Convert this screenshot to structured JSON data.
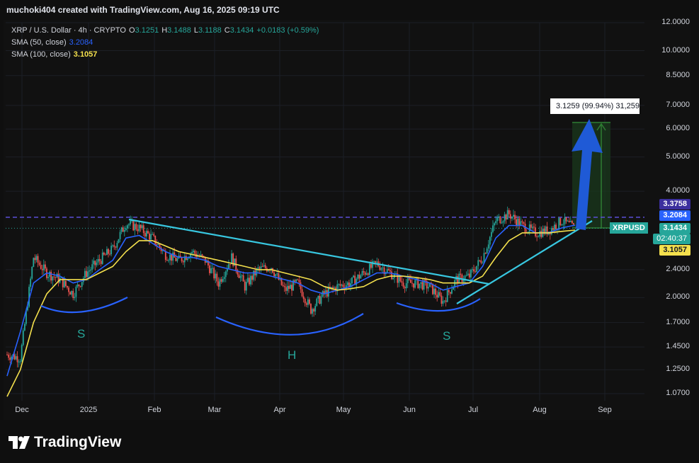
{
  "header": {
    "attribution": "muchoki404 created with TradingView.com, Aug 16, 2025 09:19 UTC"
  },
  "legend": {
    "symbol": "XRP / U.S. Dollar · 4h · CRYPTO",
    "open_key": "O",
    "open": "3.1251",
    "high_key": "H",
    "high": "3.1488",
    "low_key": "L",
    "low": "3.1188",
    "close_key": "C",
    "close": "3.1434",
    "change": "+0.0183 (+0.59%)",
    "sma50_label": "SMA (50, close)",
    "sma50_value": "3.2084",
    "sma100_label": "SMA (100, close)",
    "sma100_value": "3.1057"
  },
  "price_scale": {
    "ticks": [
      "12.0000",
      "10.0000",
      "8.5000",
      "7.0000",
      "6.0000",
      "5.0000",
      "4.0000",
      "2.4000",
      "2.0000",
      "1.7000",
      "1.4500",
      "1.2500",
      "1.0700"
    ],
    "tags": {
      "resistance": "3.3758",
      "sma50": "3.2084",
      "last_price": "3.1434",
      "countdown": "02:40:37",
      "sma100": "3.1057"
    }
  },
  "time_scale": {
    "ticks": [
      "Dec",
      "2025",
      "Feb",
      "Mar",
      "Apr",
      "May",
      "Jun",
      "Jul",
      "Aug",
      "Sep"
    ]
  },
  "annotations": {
    "target_box_label": "3.1259 (99.94%) 31,259",
    "symbol_tag": "XRPUSD",
    "left_shoulder": "S",
    "head": "H",
    "right_shoulder": "S"
  },
  "brand": {
    "name": "TradingView"
  },
  "colors": {
    "up": "#26a69a",
    "down": "#ef5350",
    "sma50": "#2962ff",
    "sma100": "#f4e04d",
    "neckline": "#38c7e0",
    "resistance": "#5b4fd8",
    "target_arrow": "#1f5ad6",
    "target_box": "#1b5e20"
  },
  "chart_data": {
    "type": "candlestick",
    "title": "XRP / U.S. Dollar · 4h · CRYPTO",
    "y_scale": "log",
    "ylim": [
      1.0,
      12.6
    ],
    "x": [
      "Nov 27",
      "Dec 3",
      "Dec 9",
      "Dec 15",
      "Dec 21",
      "Dec 27",
      "Jan 2",
      "Jan 8",
      "Jan 14",
      "Jan 18",
      "Jan 24",
      "Jan 30",
      "Feb 3",
      "Feb 9",
      "Feb 15",
      "Feb 21",
      "Feb 27",
      "Mar 3",
      "Mar 9",
      "Mar 15",
      "Mar 21",
      "Mar 27",
      "Apr 3",
      "Apr 7",
      "Apr 12",
      "Apr 20",
      "Apr 27",
      "May 5",
      "May 12",
      "May 20",
      "May 28",
      "Jun 5",
      "Jun 13",
      "Jun 21",
      "Jun 28",
      "Jul 4",
      "Jul 10",
      "Jul 15",
      "Jul 18",
      "Jul 24",
      "Jul 30",
      "Aug 5",
      "Aug 10",
      "Aug 16"
    ],
    "close": [
      1.38,
      1.35,
      2.6,
      2.35,
      2.25,
      2.05,
      2.35,
      2.55,
      2.75,
      3.25,
      3.15,
      2.95,
      2.65,
      2.55,
      2.7,
      2.55,
      2.2,
      2.6,
      2.15,
      2.4,
      2.45,
      2.1,
      2.2,
      1.85,
      2.05,
      2.15,
      2.2,
      2.35,
      2.5,
      2.35,
      2.2,
      2.2,
      2.15,
      1.95,
      2.25,
      2.3,
      2.6,
      3.3,
      3.45,
      3.2,
      3.05,
      3.1,
      3.3,
      3.14
    ],
    "series": [
      {
        "name": "SMA (50, close)",
        "last_value": 3.2084,
        "values": [
          1.2,
          1.6,
          2.2,
          2.35,
          2.3,
          2.2,
          2.25,
          2.4,
          2.55,
          2.95,
          3.0,
          2.85,
          2.7,
          2.6,
          2.6,
          2.55,
          2.45,
          2.4,
          2.35,
          2.35,
          2.3,
          2.25,
          2.2,
          2.1,
          2.05,
          2.1,
          2.15,
          2.25,
          2.35,
          2.35,
          2.3,
          2.25,
          2.2,
          2.1,
          2.15,
          2.2,
          2.45,
          2.95,
          3.2,
          3.2,
          3.05,
          3.05,
          3.15,
          3.2084
        ]
      },
      {
        "name": "SMA (100, close)",
        "last_value": 3.1057,
        "values": [
          1.05,
          1.25,
          1.7,
          2.05,
          2.25,
          2.25,
          2.25,
          2.35,
          2.45,
          2.7,
          2.9,
          2.9,
          2.8,
          2.7,
          2.65,
          2.6,
          2.55,
          2.5,
          2.45,
          2.4,
          2.4,
          2.35,
          2.3,
          2.25,
          2.15,
          2.1,
          2.12,
          2.15,
          2.25,
          2.3,
          2.3,
          2.28,
          2.25,
          2.2,
          2.2,
          2.2,
          2.3,
          2.6,
          2.9,
          3.05,
          3.05,
          3.05,
          3.08,
          3.1057
        ]
      }
    ],
    "levels": {
      "resistance": 3.3758,
      "last_price": 3.1434
    },
    "pattern": "inverse head and shoulders"
  }
}
